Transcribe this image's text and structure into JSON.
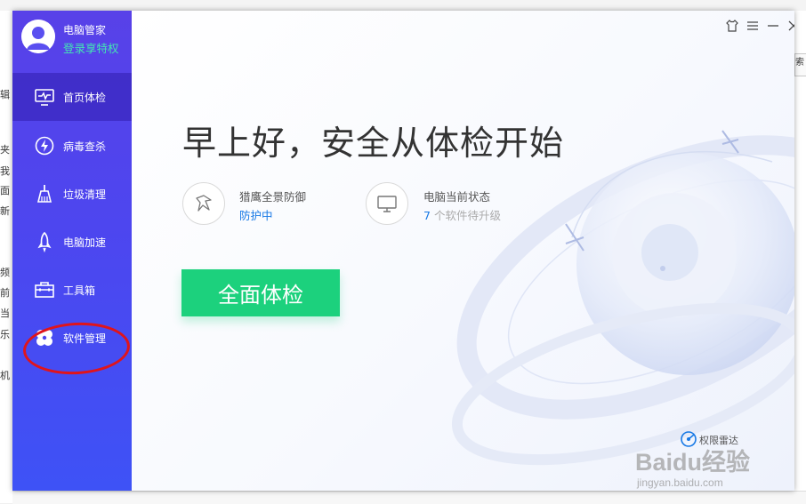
{
  "profile": {
    "name": "电脑管家",
    "login_link": "登录享特权"
  },
  "sidebar": {
    "items": [
      {
        "label": "首页体检",
        "icon": "monitor-pulse-icon",
        "active": true
      },
      {
        "label": "病毒查杀",
        "icon": "lightning-shield-icon",
        "active": false
      },
      {
        "label": "垃圾清理",
        "icon": "broom-icon",
        "active": false
      },
      {
        "label": "电脑加速",
        "icon": "rocket-icon",
        "active": false
      },
      {
        "label": "工具箱",
        "icon": "toolbox-icon",
        "active": false
      },
      {
        "label": "软件管理",
        "icon": "software-manager-icon",
        "active": false
      }
    ]
  },
  "window_controls": [
    "skin-icon",
    "menu-icon",
    "minimize-icon",
    "close-icon"
  ],
  "main": {
    "greeting": "早上好，安全从体检开始",
    "protection": {
      "title": "猎鹰全景防御",
      "status": "防护中",
      "icon": "falcon-icon"
    },
    "pc_status": {
      "title": "电脑当前状态",
      "count": "7",
      "suffix": "个软件待升级",
      "icon": "computer-icon"
    },
    "scan_button": "全面体检",
    "brand_text": "权限雷达"
  },
  "watermark": {
    "line1": "Baidu经验",
    "line2": "jingyan.baidu.com"
  },
  "background": {
    "left_chars": [
      "夹",
      "我",
      "面",
      "新",
      "频",
      "前",
      "当",
      "乐",
      "机"
    ],
    "right_char": "索",
    "left_label": "辑"
  },
  "colors": {
    "sidebar": "#4d46ef",
    "accent_green": "#1cd17d",
    "link_blue": "#1678e5",
    "login_green": "#43e6b3",
    "annotation_red": "#e0141b"
  }
}
